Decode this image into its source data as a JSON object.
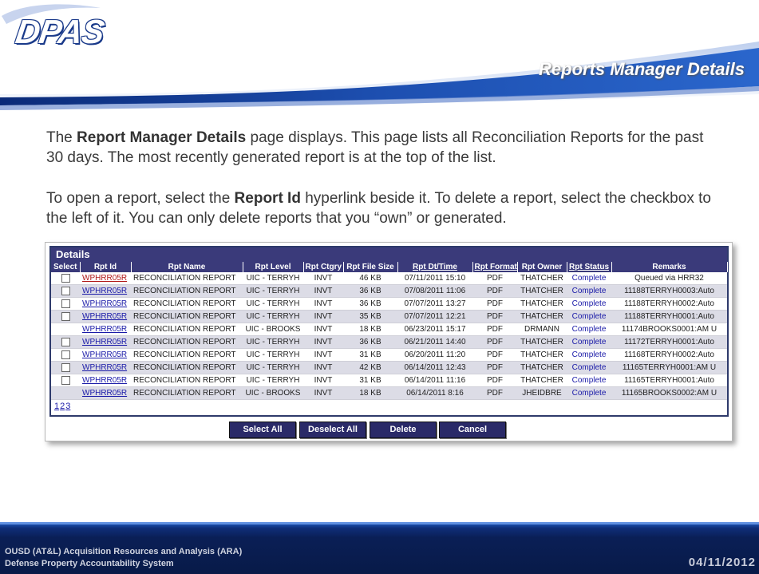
{
  "header": {
    "logo_text": "DPAS",
    "slide_title": "Reports Manager Details"
  },
  "body": {
    "p1_pre": "The ",
    "p1_bold": "Report Manager Details",
    "p1_post": " page displays. This page lists all Reconciliation Reports for the past 30 days. The most recently generated report is at the top of the list.",
    "p2_pre": "To open a report, select the ",
    "p2_bold": "Report Id",
    "p2_post": " hyperlink beside it. To delete a report, select the checkbox to the left of it. You can only delete reports that you “own” or generated."
  },
  "details": {
    "title": "Details",
    "columns": [
      "Select",
      "Rpt Id",
      "Rpt Name",
      "Rpt Level",
      "Rpt Ctgry",
      "Rpt File Size",
      "Rpt Dt/Time",
      "Rpt Format",
      "Rpt Owner",
      "Rpt Status",
      "Remarks"
    ],
    "rows": [
      {
        "checkbox": true,
        "id": "WPHRR05R",
        "name": "RECONCILIATION REPORT",
        "level": "UIC - TERRYH",
        "ctgry": "INVT",
        "size": "46 KB",
        "dt": "07/11/2011 15:10",
        "format": "PDF",
        "owner": "THATCHER",
        "status": "Complete",
        "remarks": "Queued via HRR32"
      },
      {
        "checkbox": true,
        "id": "WPHRR05R",
        "name": "RECONCILIATION REPORT",
        "level": "UIC - TERRYH",
        "ctgry": "INVT",
        "size": "36 KB",
        "dt": "07/08/2011 11:06",
        "format": "PDF",
        "owner": "THATCHER",
        "status": "Complete",
        "remarks": "11188TERRYH0003:Auto"
      },
      {
        "checkbox": true,
        "id": "WPHRR05R",
        "name": "RECONCILIATION REPORT",
        "level": "UIC - TERRYH",
        "ctgry": "INVT",
        "size": "36 KB",
        "dt": "07/07/2011 13:27",
        "format": "PDF",
        "owner": "THATCHER",
        "status": "Complete",
        "remarks": "11188TERRYH0002:Auto"
      },
      {
        "checkbox": true,
        "id": "WPHRR05R",
        "name": "RECONCILIATION REPORT",
        "level": "UIC - TERRYH",
        "ctgry": "INVT",
        "size": "35 KB",
        "dt": "07/07/2011 12:21",
        "format": "PDF",
        "owner": "THATCHER",
        "status": "Complete",
        "remarks": "11188TERRYH0001:Auto"
      },
      {
        "checkbox": false,
        "id": "WPHRR05R",
        "name": "RECONCILIATION REPORT",
        "level": "UIC - BROOKS",
        "ctgry": "INVT",
        "size": "18 KB",
        "dt": "06/23/2011 15:17",
        "format": "PDF",
        "owner": "DRMANN",
        "status": "Complete",
        "remarks": "11174BROOKS0001:AM U"
      },
      {
        "checkbox": true,
        "id": "WPHRR05R",
        "name": "RECONCILIATION REPORT",
        "level": "UIC - TERRYH",
        "ctgry": "INVT",
        "size": "36 KB",
        "dt": "06/21/2011 14:40",
        "format": "PDF",
        "owner": "THATCHER",
        "status": "Complete",
        "remarks": "11172TERRYH0001:Auto"
      },
      {
        "checkbox": true,
        "id": "WPHRR05R",
        "name": "RECONCILIATION REPORT",
        "level": "UIC - TERRYH",
        "ctgry": "INVT",
        "size": "31 KB",
        "dt": "06/20/2011 11:20",
        "format": "PDF",
        "owner": "THATCHER",
        "status": "Complete",
        "remarks": "11168TERRYH0002:Auto"
      },
      {
        "checkbox": true,
        "id": "WPHRR05R",
        "name": "RECONCILIATION REPORT",
        "level": "UIC - TERRYH",
        "ctgry": "INVT",
        "size": "42 KB",
        "dt": "06/14/2011 12:43",
        "format": "PDF",
        "owner": "THATCHER",
        "status": "Complete",
        "remarks": "11165TERRYH0001:AM U"
      },
      {
        "checkbox": true,
        "id": "WPHRR05R",
        "name": "RECONCILIATION REPORT",
        "level": "UIC - TERRYH",
        "ctgry": "INVT",
        "size": "31 KB",
        "dt": "06/14/2011 11:16",
        "format": "PDF",
        "owner": "THATCHER",
        "status": "Complete",
        "remarks": "11165TERRYH0001:Auto"
      },
      {
        "checkbox": false,
        "id": "WPHRR05R",
        "name": "RECONCILIATION REPORT",
        "level": "UIC - BROOKS",
        "ctgry": "INVT",
        "size": "18 KB",
        "dt": "06/14/2011 8:16",
        "format": "PDF",
        "owner": "JHEIDBRE",
        "status": "Complete",
        "remarks": "11165BROOKS0002:AM U"
      }
    ],
    "pages": [
      "1",
      "2",
      "3"
    ]
  },
  "buttons": {
    "select_all": "Select All",
    "deselect_all": "Deselect All",
    "delete": "Delete",
    "cancel": "Cancel"
  },
  "footer": {
    "line1": "OUSD (AT&L) Acquisition Resources and Analysis (ARA)",
    "line2": "Defense Property Accountability System",
    "date": "04/11/2012"
  }
}
